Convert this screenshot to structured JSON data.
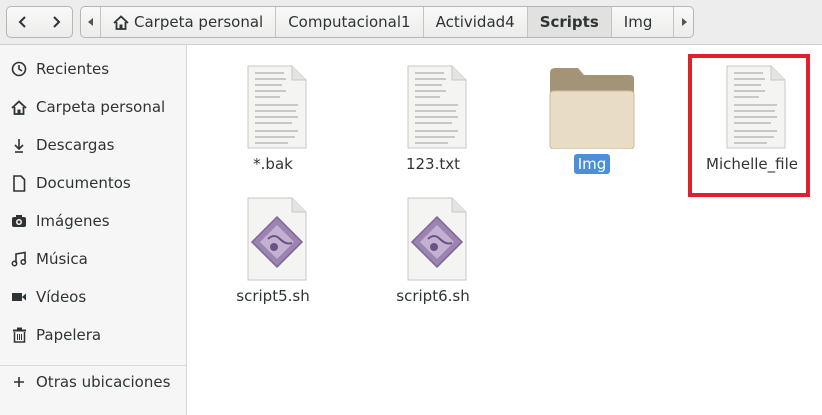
{
  "pathbar": {
    "crumbs": [
      "Carpeta personal",
      "Computacional1",
      "Actividad4",
      "Scripts",
      "Img"
    ],
    "current_index": 3
  },
  "sidebar": {
    "items": [
      {
        "label": "Recientes",
        "icon": "clock-icon"
      },
      {
        "label": "Carpeta personal",
        "icon": "home-icon"
      },
      {
        "label": "Descargas",
        "icon": "download-icon"
      },
      {
        "label": "Documentos",
        "icon": "document-icon"
      },
      {
        "label": "Imágenes",
        "icon": "camera-icon"
      },
      {
        "label": "Música",
        "icon": "music-icon"
      },
      {
        "label": "Vídeos",
        "icon": "video-icon"
      },
      {
        "label": "Papelera",
        "icon": "trash-icon"
      }
    ],
    "other_locations": {
      "label": "Otras ubicaciones",
      "icon": "plus-icon"
    }
  },
  "files": [
    {
      "name": "*.bak",
      "type": "text-file-icon"
    },
    {
      "name": "123.txt",
      "type": "text-file-icon"
    },
    {
      "name": "Img",
      "type": "folder-icon",
      "selected": true
    },
    {
      "name": "Michelle_file",
      "type": "text-file-icon",
      "highlighted": true
    },
    {
      "name": "script5.sh",
      "type": "script-file-icon"
    },
    {
      "name": "script6.sh",
      "type": "script-file-icon"
    }
  ],
  "colors": {
    "selection": "#4a90d9",
    "highlight_box": "#e0202b"
  }
}
